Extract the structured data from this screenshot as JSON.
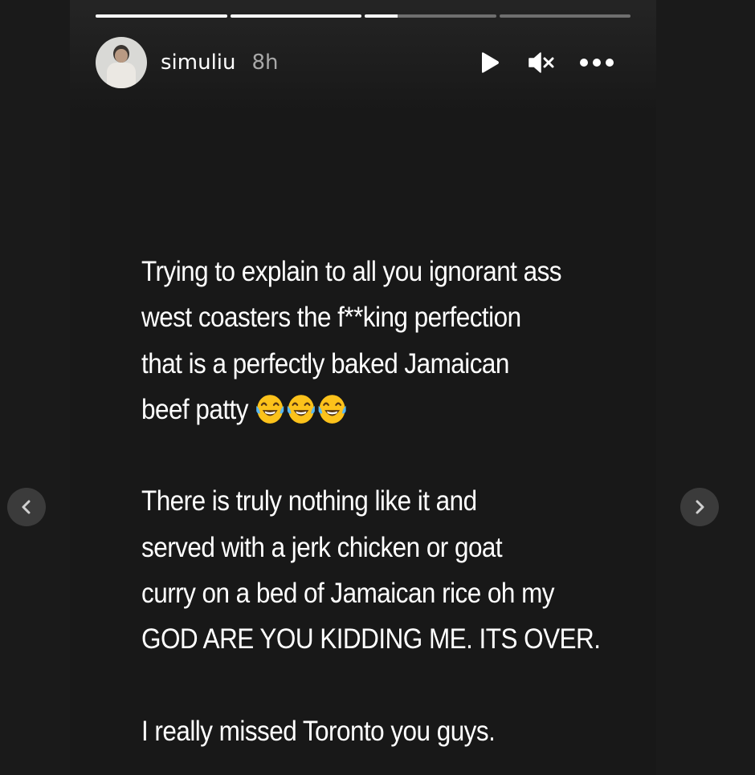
{
  "story": {
    "username": "simuliu",
    "timestamp": "8h",
    "progress": [
      1,
      1,
      0.25,
      0
    ],
    "controls": {
      "play_icon": "play-icon",
      "mute_icon": "speaker-muted-icon",
      "more_icon": "more-horizontal-icon"
    },
    "text": {
      "p1_l1": "Trying to explain to all you ignorant ass",
      "p1_l2": "west coasters the f**king perfection",
      "p1_l3": "that is a perfectly baked Jamaican",
      "p1_l4": "beef patty",
      "p1_emoji": "😂😂😂",
      "p2_l1": "There is truly nothing like it and",
      "p2_l2": "served with a jerk chicken or goat",
      "p2_l3": "curry on a bed of Jamaican rice oh my",
      "p2_l4": "GOD ARE YOU KIDDING ME. ITS OVER.",
      "p3_l1": "I really missed Toronto you guys."
    }
  },
  "navigation": {
    "prev_icon": "chevron-left-icon",
    "next_icon": "chevron-right-icon"
  },
  "colors": {
    "page_bg": "#1a1a1a",
    "story_bg": "#181818",
    "text": "#ffffff",
    "timestamp": "#a8a8a8",
    "nav_button": "#3b3b3b"
  }
}
